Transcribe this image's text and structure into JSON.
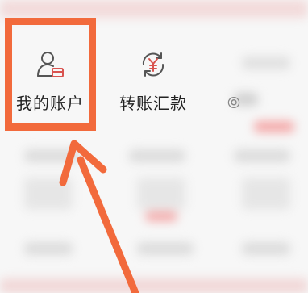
{
  "grid": {
    "items": [
      {
        "label": "我的账户",
        "icon": "user-card-icon",
        "highlighted": true
      },
      {
        "label": "转账汇款",
        "icon": "yuan-transfer-icon",
        "highlighted": false
      }
    ]
  },
  "colors": {
    "highlight": "#f26a3c",
    "icon_stroke": "#555555",
    "icon_accent": "#d9534f"
  }
}
